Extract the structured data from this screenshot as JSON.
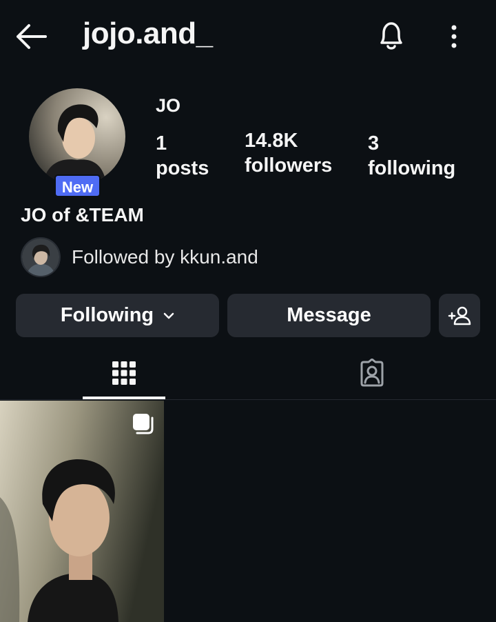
{
  "header": {
    "username": "jojo.and_",
    "icons": {
      "back": "arrow-left-icon",
      "bell": "bell-icon",
      "more": "more-vertical-icon"
    }
  },
  "profile": {
    "display_name": "JO",
    "new_badge": "New",
    "bio": "JO of &TEAM",
    "stats": {
      "posts": {
        "value": "1",
        "label": "posts"
      },
      "followers": {
        "value": "14.8K",
        "label": "followers"
      },
      "following": {
        "value": "3",
        "label": "following"
      }
    },
    "followed_by": "Followed by kkun.and"
  },
  "actions": {
    "following_label": "Following",
    "message_label": "Message",
    "add_icon": "add-person-icon"
  },
  "tabs": [
    {
      "name": "grid",
      "icon": "grid-icon",
      "active": true
    },
    {
      "name": "tagged",
      "icon": "tagged-person-icon",
      "active": false
    }
  ],
  "posts": [
    {
      "type": "carousel",
      "icon": "multiple-media-icon"
    }
  ],
  "colors": {
    "background": "#0c1014",
    "button": "#262a31",
    "badge": "#4f6cf4",
    "text": "#f5f5f5"
  }
}
